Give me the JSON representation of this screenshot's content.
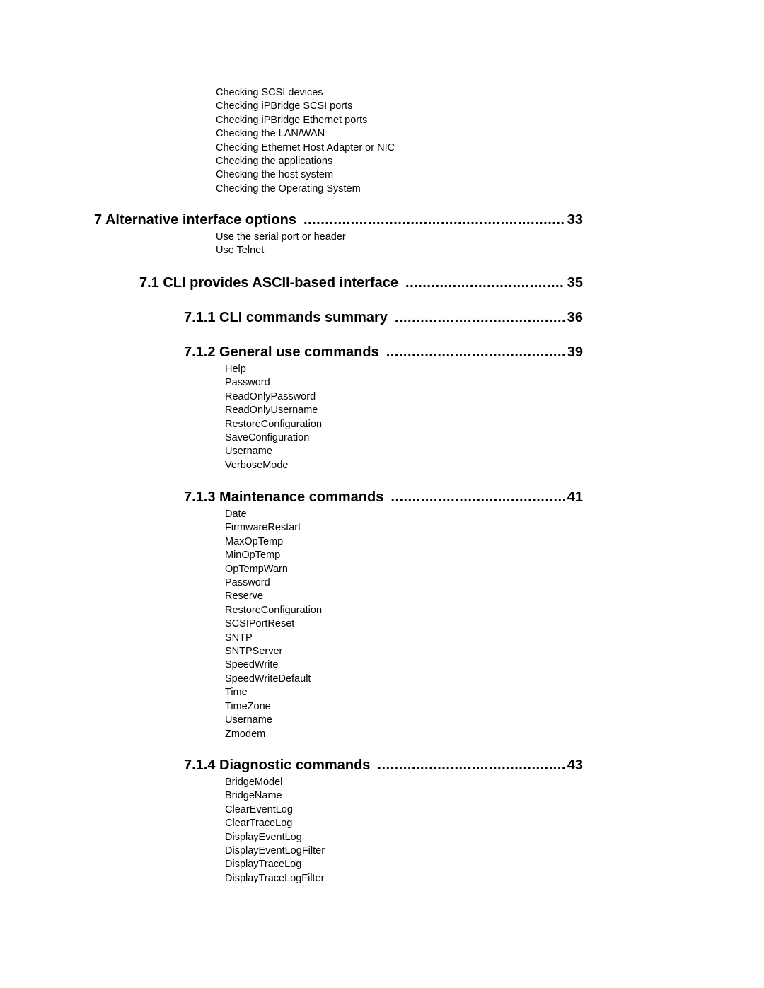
{
  "toc": {
    "intro_items": [
      "Checking SCSI devices",
      "Checking iPBridge SCSI ports",
      "Checking iPBridge Ethernet ports",
      "Checking the LAN/WAN",
      "Checking Ethernet Host Adapter or NIC",
      "Checking the applications",
      "Checking the host system",
      "Checking the Operating System"
    ],
    "sections": [
      {
        "title": "7 Alternative interface options",
        "page": "33",
        "items": [
          "Use the serial port or header",
          "Use Telnet"
        ]
      },
      {
        "title": "7.1 CLI provides ASCII-based interface",
        "page": "35",
        "items": []
      },
      {
        "title": "7.1.1 CLI commands summary",
        "page": "36",
        "items": []
      },
      {
        "title": "7.1.2 General use commands",
        "page": "39",
        "items": [
          "Help",
          "Password",
          "ReadOnlyPassword",
          "ReadOnlyUsername",
          "RestoreConfiguration",
          "SaveConfiguration",
          "Username",
          "VerboseMode"
        ]
      },
      {
        "title": "7.1.3 Maintenance commands",
        "page": "41",
        "items": [
          "Date",
          "FirmwareRestart",
          "MaxOpTemp",
          "MinOpTemp",
          "OpTempWarn",
          "Password",
          "Reserve",
          "RestoreConfiguration",
          "SCSIPortReset",
          "SNTP",
          "SNTPServer",
          "SpeedWrite",
          "SpeedWriteDefault",
          "Time",
          "TimeZone",
          "Username",
          "Zmodem"
        ]
      },
      {
        "title": "7.1.4 Diagnostic commands",
        "page": "43",
        "items": [
          "BridgeModel",
          "BridgeName",
          "ClearEventLog",
          "ClearTraceLog",
          "DisplayEventLog",
          "DisplayEventLogFilter",
          "DisplayTraceLog",
          "DisplayTraceLogFilter"
        ]
      }
    ]
  }
}
